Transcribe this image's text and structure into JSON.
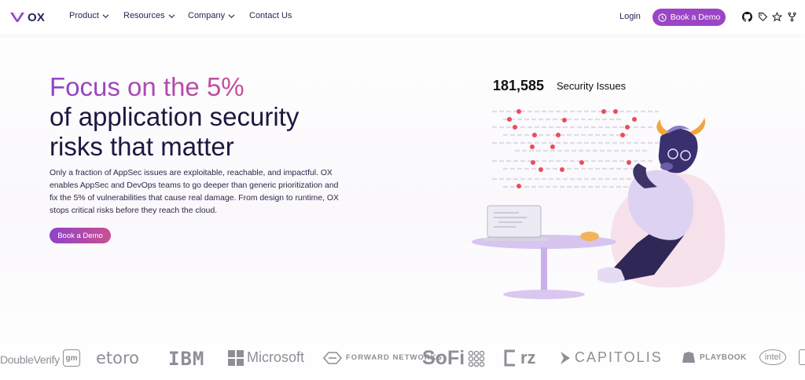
{
  "nav": {
    "logo_text": "OX",
    "items": [
      {
        "label": "Product"
      },
      {
        "label": "Resources"
      },
      {
        "label": "Company"
      },
      {
        "label": "Contact Us"
      }
    ],
    "login_label": "Login",
    "demo_label": "Book a Demo",
    "icons": [
      "github-icon",
      "tag-icon",
      "star-icon",
      "fork-icon"
    ]
  },
  "hero": {
    "title_highlight": "Focus on the 5%",
    "title_line2": "of application security",
    "title_line3": "risks that matter",
    "description": "Only a fraction of AppSec issues are exploitable, reachable, and impactful. OX enables AppSec and DevOps teams to go deeper than generic prioritization and fix the 5% of vulnerabilities that cause real damage. From design to runtime, OX stops critical risks before they reach the cloud.",
    "cta_label": "Book a Demo"
  },
  "illustration": {
    "issue_count": "181,585",
    "issue_label": "Security Issues"
  },
  "customers": [
    "DoubleVerify",
    "gm",
    "etoro",
    "IBM",
    "Microsoft",
    "FORWARD NETWORKS",
    "SoFi",
    "rz",
    "CAPITOLIS",
    "PLAYBOOK",
    "intel"
  ],
  "colors": {
    "brand_purple": "#9b45c6",
    "gradient_start": "#8d43c9",
    "gradient_end": "#f07d65",
    "text_dark": "#1d1740"
  }
}
